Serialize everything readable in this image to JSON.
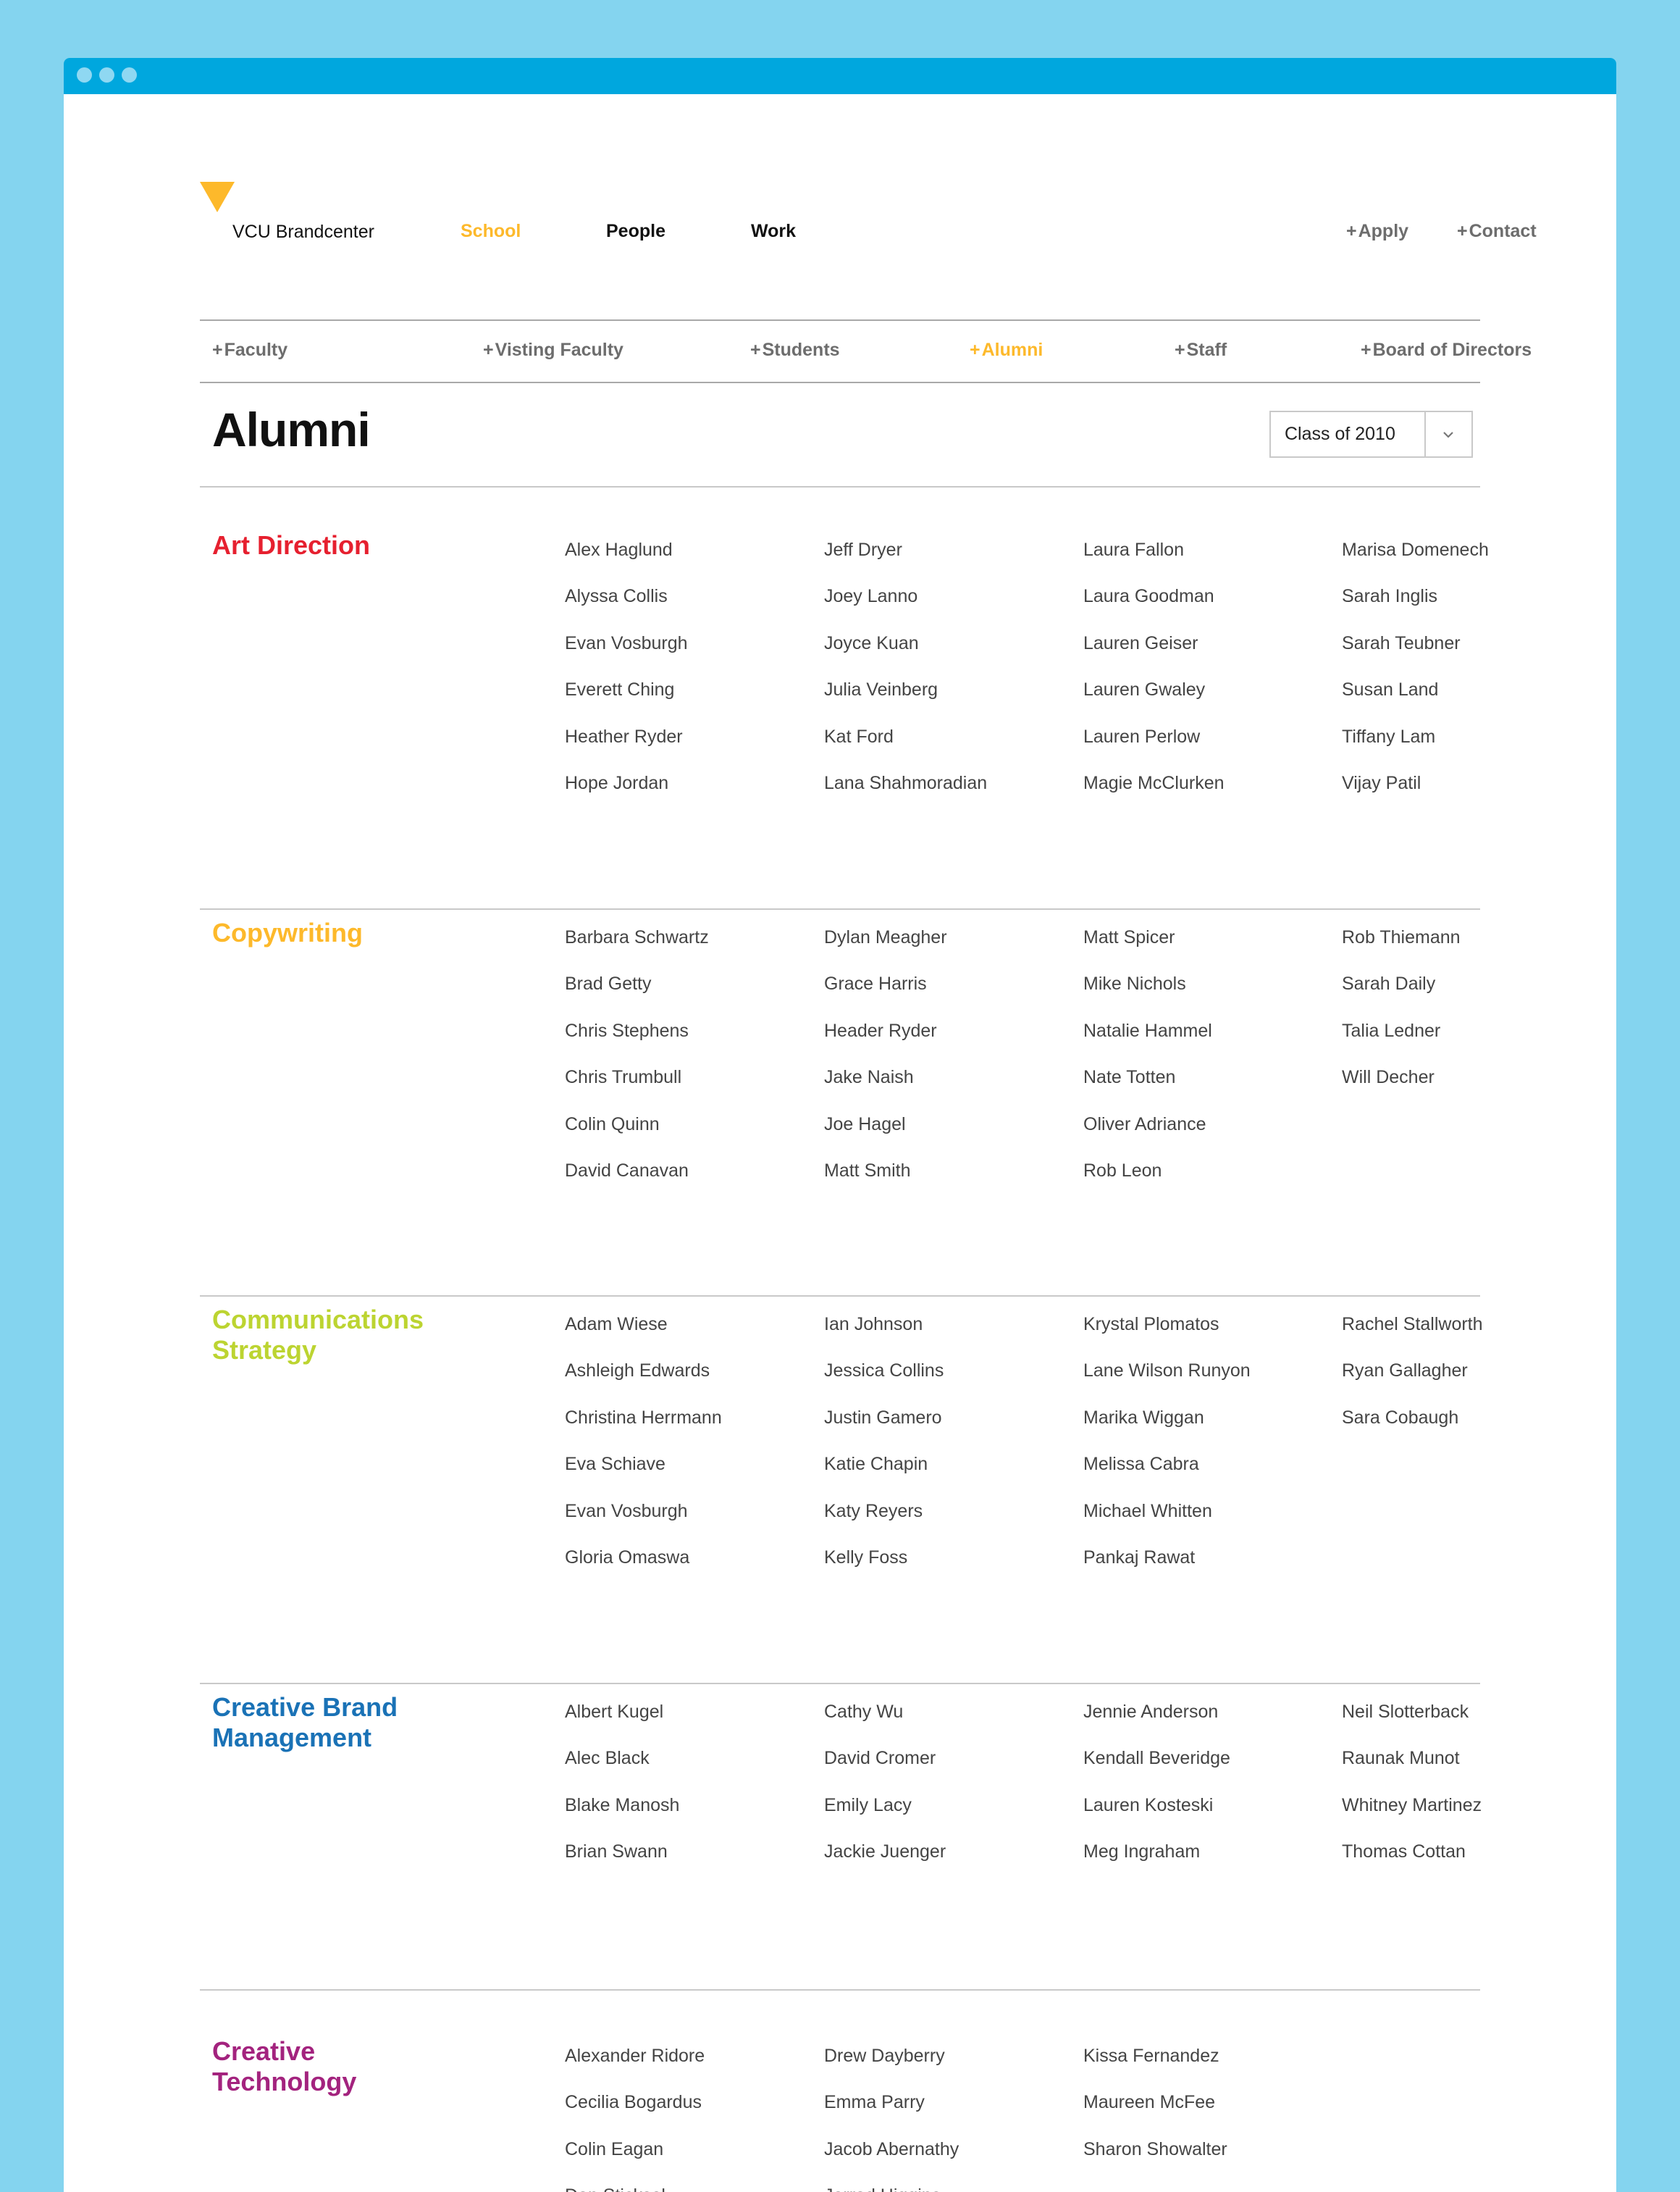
{
  "brand": {
    "name": "VCU Brandcenter",
    "color": "#fdb92b"
  },
  "main_nav": [
    {
      "label": "School",
      "active": true
    },
    {
      "label": "People",
      "active": false
    },
    {
      "label": "Work",
      "active": false
    }
  ],
  "top_actions": [
    {
      "plus": "+",
      "label": "Apply"
    },
    {
      "plus": "+",
      "label": "Contact"
    }
  ],
  "sub_nav": [
    {
      "plus": "+",
      "label": "Faculty",
      "active": false
    },
    {
      "plus": "+",
      "label": "Visting Faculty",
      "active": false
    },
    {
      "plus": "+",
      "label": "Students",
      "active": false
    },
    {
      "plus": "+",
      "label": "Alumni",
      "active": true
    },
    {
      "plus": "+",
      "label": "Staff",
      "active": false
    },
    {
      "plus": "+",
      "label": "Board of Directors",
      "active": false
    }
  ],
  "page": {
    "title": "Alumni",
    "class_select": {
      "value": "Class of 2010",
      "icon": "chevron-down-icon"
    }
  },
  "colors": {
    "art_direction": "#e6202f",
    "copywriting": "#fdb92b",
    "communications_strategy": "#bcd431",
    "creative_brand_management": "#1a72b6",
    "creative_technology": "#a3237e",
    "accent_chrome": "#00a7de",
    "background": "#84d4ef"
  },
  "sections": [
    {
      "title": "Art Direction",
      "columns": [
        [
          "Alex Haglund",
          "Alyssa Collis",
          "Evan Vosburgh",
          "Everett Ching",
          "Heather Ryder",
          "Hope Jordan"
        ],
        [
          "Jeff Dryer",
          "Joey Lanno",
          "Joyce Kuan",
          "Julia Veinberg",
          "Kat Ford",
          "Lana Shahmoradian"
        ],
        [
          "Laura Fallon",
          "Laura Goodman",
          "Lauren Geiser",
          "Lauren Gwaley",
          "Lauren Perlow",
          "Magie McClurken"
        ],
        [
          "Marisa Domenech",
          "Sarah Inglis",
          "Sarah Teubner",
          "Susan Land",
          "Tiffany Lam",
          "Vijay Patil"
        ]
      ]
    },
    {
      "title": "Copywriting",
      "columns": [
        [
          "Barbara Schwartz",
          "Brad Getty",
          "Chris Stephens",
          "Chris Trumbull",
          "Colin Quinn",
          "David Canavan"
        ],
        [
          "Dylan Meagher",
          "Grace Harris",
          "Header Ryder",
          "Jake  Naish",
          "Joe Hagel",
          "Matt Smith"
        ],
        [
          "Matt Spicer",
          "Mike Nichols",
          "Natalie Hammel",
          "Nate Totten",
          "Oliver  Adriance",
          "Rob Leon"
        ],
        [
          "Rob Thiemann",
          "Sarah Daily",
          "Talia Ledner",
          "Will Decher"
        ]
      ]
    },
    {
      "title": "Communications Strategy",
      "columns": [
        [
          "Adam Wiese",
          "Ashleigh Edwards",
          "Christina Herrmann",
          "Eva Schiave",
          "Evan Vosburgh",
          "Gloria Omaswa"
        ],
        [
          "Ian Johnson",
          "Jessica Collins",
          "Justin Gamero",
          "Katie Chapin",
          "Katy Reyers",
          "Kelly Foss"
        ],
        [
          "Krystal Plomatos",
          "Lane Wilson Runyon",
          "Marika Wiggan",
          "Melissa Cabra",
          "Michael Whitten",
          "Pankaj Rawat"
        ],
        [
          "Rachel Stallworth",
          "Ryan Gallagher",
          "Sara Cobaugh"
        ]
      ]
    },
    {
      "title": "Creative Brand Management",
      "columns": [
        [
          "Albert Kugel",
          "Alec Black",
          "Blake Manosh",
          "Brian Swann"
        ],
        [
          "Cathy Wu",
          "David Cromer",
          "Emily Lacy",
          "Jackie Juenger"
        ],
        [
          "Jennie Anderson",
          "Kendall Beveridge",
          "Lauren Kosteski",
          "Meg Ingraham"
        ],
        [
          "Neil Slotterback",
          "Raunak Munot",
          "Whitney Martinez",
          "Thomas Cottan"
        ]
      ]
    },
    {
      "title": "Creative Technology",
      "columns": [
        [
          "Alexander Ridore",
          "Cecilia Bogardus",
          "Colin Eagan",
          "Don Sticksel"
        ],
        [
          "Drew Dayberry",
          "Emma Parry",
          "Jacob Abernathy",
          "Jarrod Higgins"
        ],
        [
          "Kissa Fernandez",
          "Maureen McFee",
          "Sharon Showalter"
        ],
        []
      ]
    }
  ]
}
